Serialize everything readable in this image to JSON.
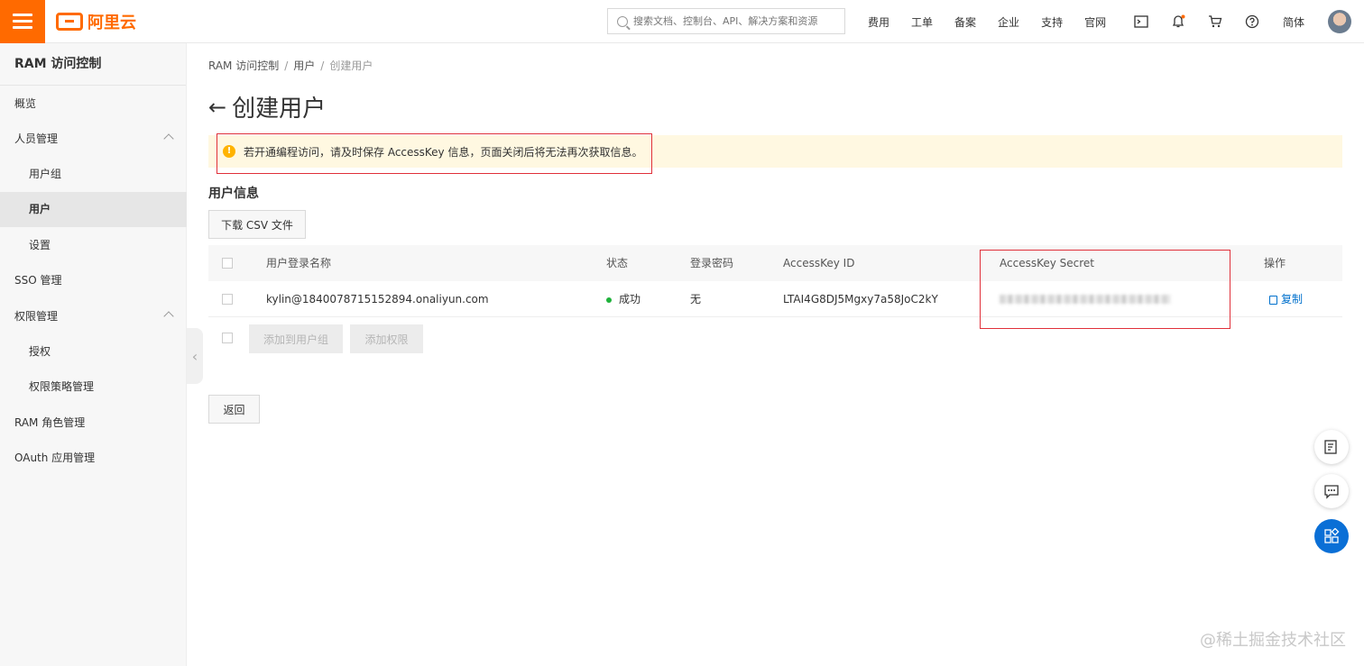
{
  "colors": {
    "brand": "#ff6a00",
    "link": "#0070cc",
    "success": "#1fb23b",
    "alert_bg": "#fff8e1",
    "highlight": "#e0303a"
  },
  "header": {
    "logo_text": "阿里云",
    "search_placeholder": "搜索文档、控制台、API、解决方案和资源",
    "nav": [
      "费用",
      "工单",
      "备案",
      "企业",
      "支持",
      "官网"
    ],
    "icons": [
      "terminal-icon",
      "bell-icon",
      "cart-icon",
      "help-icon"
    ],
    "lang": "简体"
  },
  "sidebar": {
    "title": "RAM 访问控制",
    "items": [
      {
        "label": "概览"
      },
      {
        "label": "人员管理"
      },
      {
        "label": "用户组"
      },
      {
        "label": "用户"
      },
      {
        "label": "设置"
      },
      {
        "label": "SSO 管理"
      },
      {
        "label": "权限管理"
      },
      {
        "label": "授权"
      },
      {
        "label": "权限策略管理"
      },
      {
        "label": "RAM 角色管理"
      },
      {
        "label": "OAuth 应用管理"
      }
    ]
  },
  "breadcrumb": {
    "root": "RAM 访问控制",
    "sep": "/",
    "mid": "用户",
    "current": "创建用户"
  },
  "page": {
    "back": "←",
    "title": "创建用户"
  },
  "alert": {
    "icon": "!",
    "text": "若开通编程访问，请及时保存 AccessKey 信息，页面关闭后将无法再次获取信息。"
  },
  "section": {
    "title": "用户信息",
    "download_label": "下载 CSV 文件"
  },
  "table": {
    "headers": [
      "用户登录名称",
      "状态",
      "登录密码",
      "AccessKey ID",
      "AccessKey Secret",
      "操作"
    ],
    "rows": [
      {
        "login": "kylin@1840078715152894.onaliyun.com",
        "status": "成功",
        "password": "无",
        "ak_id": "LTAI4G8DJ5Mgxy7a58JoC2kY",
        "action": "复制"
      }
    ]
  },
  "batch": {
    "add_group": "添加到用户组",
    "add_perm": "添加权限"
  },
  "return_label": "返回",
  "watermark": "@稀土掘金技术社区"
}
